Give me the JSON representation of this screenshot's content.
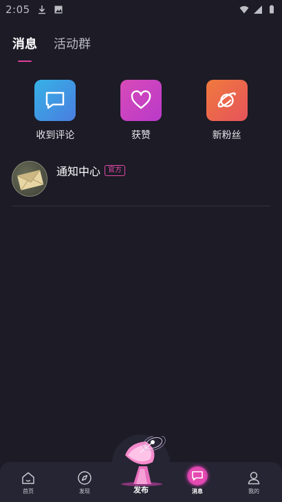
{
  "status_bar": {
    "time": "2:05"
  },
  "tabs": [
    {
      "label": "消息",
      "active": true
    },
    {
      "label": "活动群",
      "active": false
    }
  ],
  "quick_actions": [
    {
      "label": "收到评论",
      "icon": "chat-bubble-icon",
      "color": "#3fa0e4"
    },
    {
      "label": "获赞",
      "icon": "heart-icon",
      "color": "#cc43c2"
    },
    {
      "label": "新粉丝",
      "icon": "planet-icon",
      "color": "#ea6a4a"
    }
  ],
  "notice": {
    "title": "通知中心",
    "badge": "官方",
    "avatar_icon": "envelope-icon"
  },
  "bottom_nav": {
    "items": [
      {
        "label": "首页",
        "icon": "home-icon"
      },
      {
        "label": "发现",
        "icon": "compass-icon"
      },
      {
        "label": "发布",
        "icon": "satellite-dish-icon"
      },
      {
        "label": "消息",
        "icon": "message-icon",
        "active": true
      },
      {
        "label": "我的",
        "icon": "profile-icon"
      }
    ]
  },
  "colors": {
    "accent": "#e23f9e",
    "background": "#1c1b26",
    "nav_background": "#262533"
  }
}
